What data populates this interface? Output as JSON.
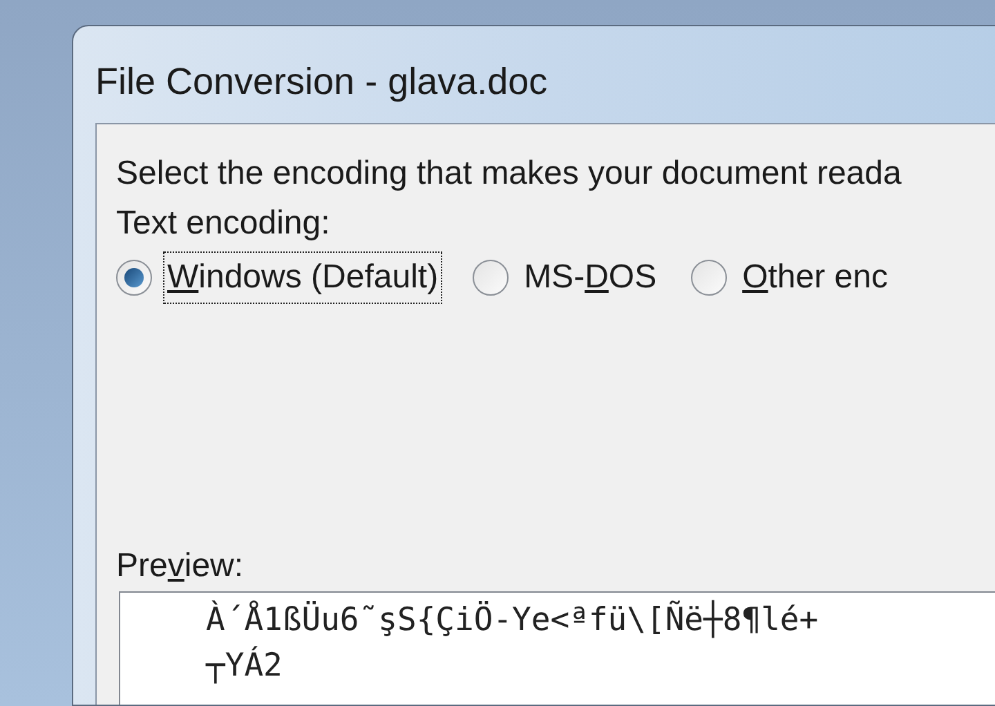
{
  "window": {
    "title": "File Conversion - glava.doc"
  },
  "instruction": "Select the encoding that makes your document reada",
  "encoding_label": "Text encoding:",
  "encodings": [
    {
      "key": "W",
      "after": "indows (Default)",
      "selected": true,
      "focused": true
    },
    {
      "before": "MS-",
      "key": "D",
      "after": "OS",
      "selected": false,
      "focused": false
    },
    {
      "key": "O",
      "after": "ther enc",
      "selected": false,
      "focused": false
    }
  ],
  "preview": {
    "label": {
      "before": "Pre",
      "key": "v",
      "after": "iew:"
    },
    "lines": [
      "À´Å1ßÜu6˜şS{ÇiÖ-Ye<ªfü\\[Ñë┼8¶lé+",
      "┬YÁ2"
    ]
  }
}
